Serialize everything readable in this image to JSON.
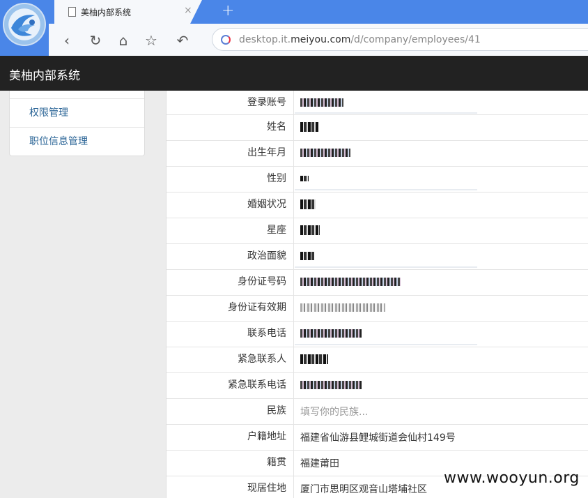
{
  "browser": {
    "tab_title": "美柚内部系统",
    "tab_close": "×",
    "new_tab": "+",
    "url_prefix": "desktop.it.",
    "url_host": "meiyou.com",
    "url_path": "/d/company/employees/41"
  },
  "app": {
    "brand": "美柚内部系统"
  },
  "sidebar": {
    "items": [
      {
        "label": "权限管理"
      },
      {
        "label": "职位信息管理"
      }
    ]
  },
  "form": {
    "rows": [
      {
        "label": "登录账号"
      },
      {
        "label": "姓名"
      },
      {
        "label": "出生年月"
      },
      {
        "label": "性别"
      },
      {
        "label": "婚姻状况"
      },
      {
        "label": "星座"
      },
      {
        "label": "政治面貌"
      },
      {
        "label": "身份证号码"
      },
      {
        "label": "身份证有效期"
      },
      {
        "label": "联系电话"
      },
      {
        "label": "紧急联系人"
      },
      {
        "label": "紧急联系电话"
      },
      {
        "label": "民族",
        "placeholder": "填写你的民族..."
      },
      {
        "label": "户籍地址",
        "value": "福建省仙游县鲤城街道会仙村149号"
      },
      {
        "label": "籍贯",
        "value": "福建莆田"
      },
      {
        "label": "现居住地",
        "value": "厦门市思明区观音山塔埔社区"
      }
    ]
  },
  "watermark": "www.wooyun.org"
}
